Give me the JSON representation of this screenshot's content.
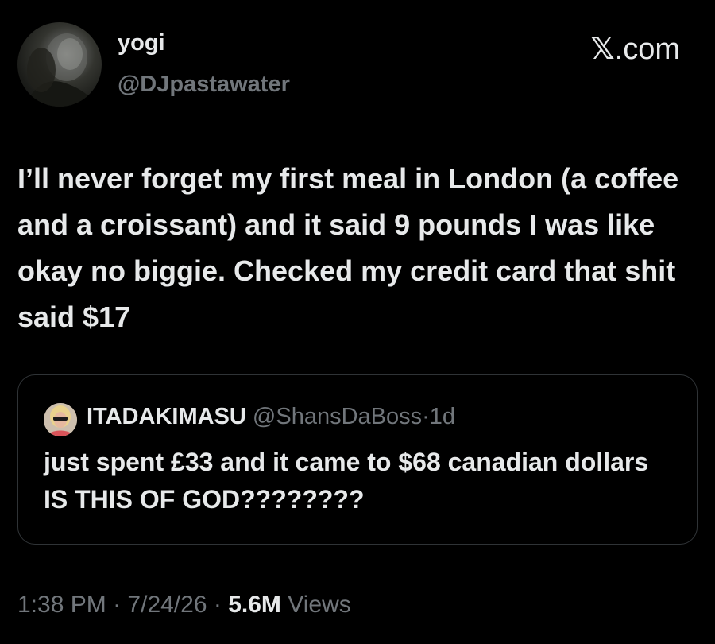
{
  "author": {
    "display_name": "yogi",
    "handle": "@DJpastawater",
    "avatar_icon": "profile-photo"
  },
  "brand": {
    "glyph": "𝕏",
    "domain": ".com"
  },
  "tweet": {
    "text": "I’ll never forget my first meal in London (a coffee and a croissant) and it said 9 pounds I was like okay no biggie. Checked my credit card that shit said $17"
  },
  "quote": {
    "display_name": "ITADAKIMASU",
    "handle": "@ShansDaBoss",
    "separator": "·",
    "time": "1d",
    "text": "just spent £33 and it came to $68 canadian dollars IS THIS OF GOD????????",
    "avatar_icon": "profile-photo"
  },
  "meta": {
    "time": "1:38 PM",
    "separator": "·",
    "date": "7/24/26",
    "views_count": "5.6M",
    "views_label": "Views"
  },
  "colors": {
    "background": "#000000",
    "primary_text": "#e7e9ea",
    "secondary_text": "#71767b",
    "border": "#2f3336"
  }
}
